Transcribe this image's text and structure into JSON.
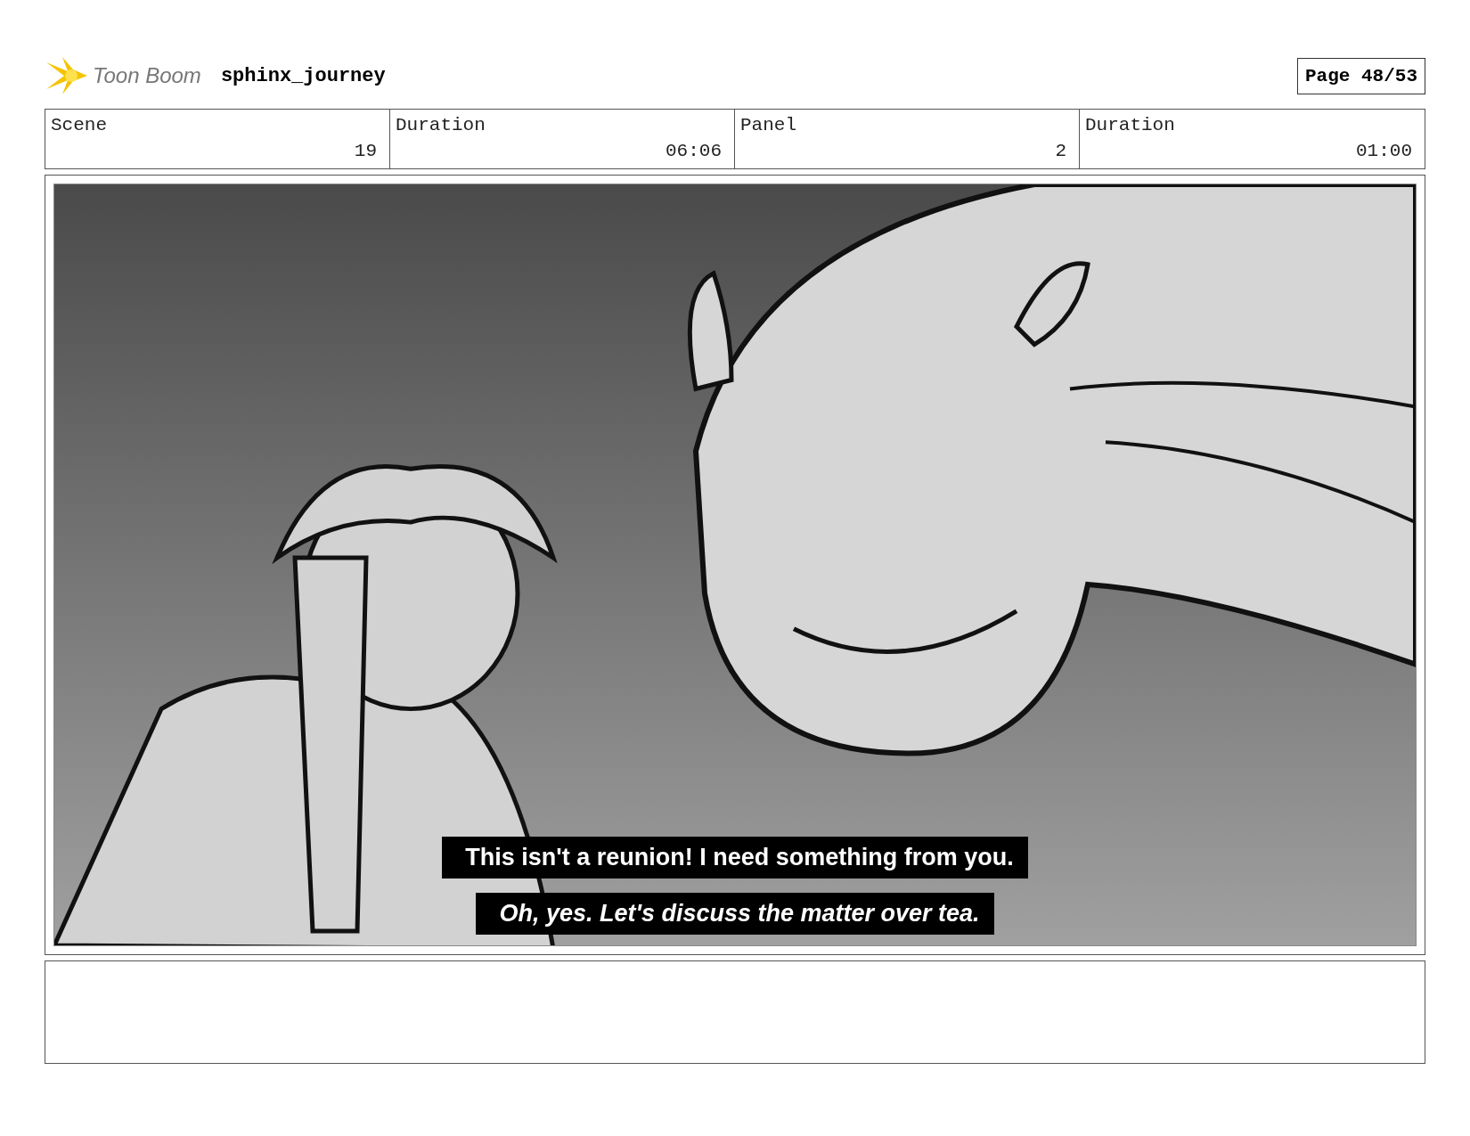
{
  "header": {
    "logo_text": "Toon Boom",
    "project": "sphinx_journey",
    "page": "Page 48/53"
  },
  "fields": [
    {
      "label": "Scene",
      "value": "19"
    },
    {
      "label": "Duration",
      "value": "06:06"
    },
    {
      "label": "Panel",
      "value": "2"
    },
    {
      "label": "Duration",
      "value": "01:00"
    }
  ],
  "panel": {
    "subtitles": [
      {
        "text": "This isn't a reunion! I need something from you.",
        "kind": "plain"
      },
      {
        "text": "Oh, yes. Let's discuss the matter over tea.",
        "kind": "italic"
      }
    ]
  }
}
